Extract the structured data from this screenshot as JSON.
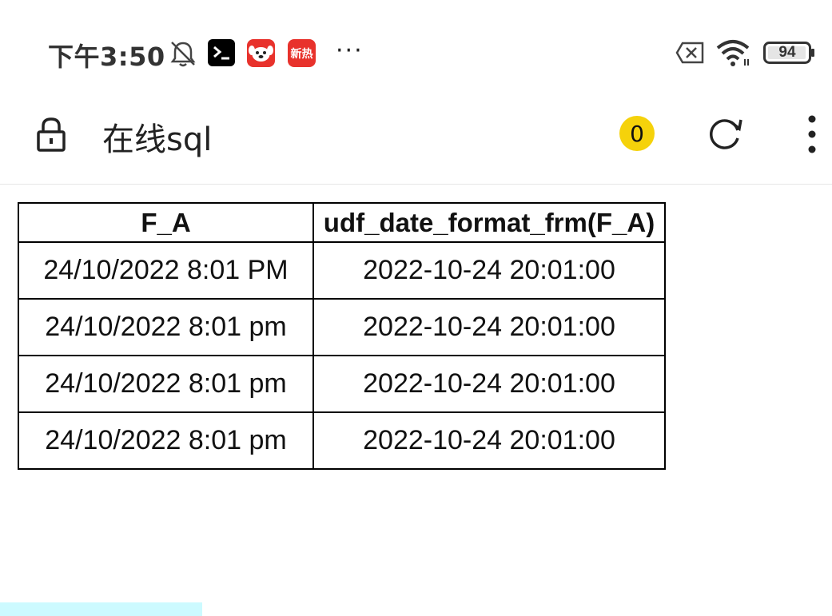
{
  "status_bar": {
    "time": "下午3:50",
    "app_icon_label": "新热",
    "more": "···",
    "battery": "94"
  },
  "app_bar": {
    "title": "在线sql",
    "badge_count": "0"
  },
  "table": {
    "headers": [
      "F_A",
      "udf_date_format_frm(F_A)"
    ],
    "rows": [
      [
        "24/10/2022 8:01 PM",
        "2022-10-24 20:01:00"
      ],
      [
        "24/10/2022 8:01 pm",
        "2022-10-24 20:01:00"
      ],
      [
        "24/10/2022 8:01 pm",
        "2022-10-24 20:01:00"
      ],
      [
        "24/10/2022 8:01 pm",
        "2022-10-24 20:01:00"
      ]
    ]
  },
  "colors": {
    "badge": "#f5d20b",
    "app_red": "#e8322c",
    "strip": "#ccfaff"
  }
}
